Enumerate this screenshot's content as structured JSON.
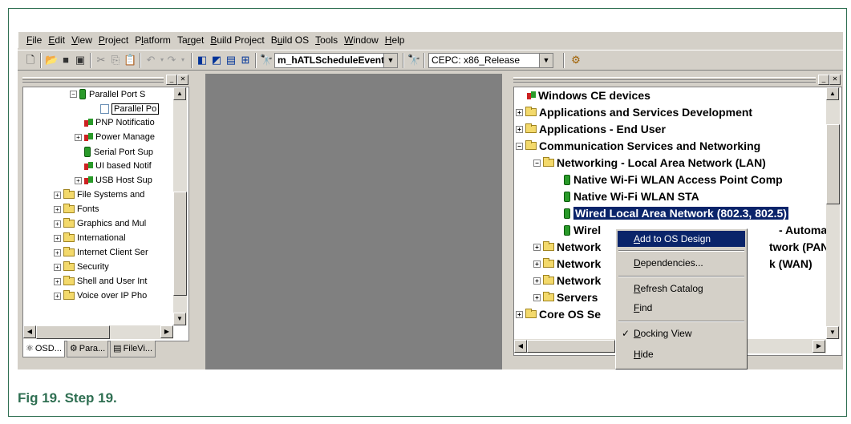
{
  "menubar": {
    "items": [
      {
        "label": "File",
        "key": "F"
      },
      {
        "label": "Edit",
        "key": "E"
      },
      {
        "label": "View",
        "key": "V"
      },
      {
        "label": "Project",
        "key": "P"
      },
      {
        "label": "Platform",
        "key": "l"
      },
      {
        "label": "Target",
        "key": "r"
      },
      {
        "label": "Build Project",
        "key": "B"
      },
      {
        "label": "Build OS",
        "key": "u"
      },
      {
        "label": "Tools",
        "key": "T"
      },
      {
        "label": "Window",
        "key": "W"
      },
      {
        "label": "Help",
        "key": "H"
      }
    ]
  },
  "toolbar": {
    "event_combo": "m_hATLScheduleEvent",
    "config_combo": "CEPC: x86_Release"
  },
  "left_tree": {
    "items": [
      {
        "label": "Parallel Port S",
        "icon": "component-icon",
        "expander": "−"
      },
      {
        "label": "Parallel Po",
        "icon": "page-icon",
        "expander": ""
      },
      {
        "label": "PNP Notificatio",
        "icon": "dual-component-icon",
        "expander": ""
      },
      {
        "label": "Power Manage",
        "icon": "dual-component-icon",
        "expander": "+"
      },
      {
        "label": "Serial Port Sup",
        "icon": "component-icon",
        "expander": ""
      },
      {
        "label": "UI based Notif",
        "icon": "dual-component-icon",
        "expander": ""
      },
      {
        "label": "USB Host Sup",
        "icon": "dual-component-icon",
        "expander": "+"
      },
      {
        "label": "File Systems and",
        "icon": "folder-icon",
        "expander": "+"
      },
      {
        "label": "Fonts",
        "icon": "folder-icon",
        "expander": "+"
      },
      {
        "label": "Graphics and Mul",
        "icon": "folder-icon",
        "expander": "+"
      },
      {
        "label": "International",
        "icon": "folder-icon",
        "expander": "+"
      },
      {
        "label": "Internet Client Ser",
        "icon": "folder-icon",
        "expander": "+"
      },
      {
        "label": "Security",
        "icon": "folder-icon",
        "expander": "+"
      },
      {
        "label": "Shell and User Int",
        "icon": "folder-icon",
        "expander": "+"
      },
      {
        "label": "Voice over IP Pho",
        "icon": "folder-icon",
        "expander": "+"
      }
    ],
    "tabs": [
      "OSD...",
      "Para...",
      "FileVi..."
    ]
  },
  "right_tree": {
    "items": [
      {
        "label": "Windows CE devices",
        "icon": "dual-component-icon",
        "expander": ""
      },
      {
        "label": "Applications and Services Development",
        "icon": "folder-icon",
        "expander": "+"
      },
      {
        "label": "Applications - End User",
        "icon": "folder-icon",
        "expander": "+"
      },
      {
        "label": "Communication Services and Networking",
        "icon": "open-folder-icon",
        "expander": "−"
      },
      {
        "label": "Networking - Local Area Network (LAN)",
        "icon": "open-folder-icon",
        "expander": "−"
      },
      {
        "label": "Native Wi-Fi WLAN Access Point Comp",
        "icon": "component-icon",
        "expander": ""
      },
      {
        "label": "Native Wi-Fi WLAN STA",
        "icon": "component-icon",
        "expander": ""
      },
      {
        "label": "Wired Local Area Network (802.3, 802.5)",
        "icon": "component-icon",
        "expander": ""
      },
      {
        "label": "Wirel",
        "icon": "component-icon",
        "expander": "",
        "tail": "- Automatic"
      },
      {
        "label": "Network",
        "icon": "folder-icon",
        "expander": "+",
        "tail": "twork (PAN)"
      },
      {
        "label": "Network",
        "icon": "folder-icon",
        "expander": "+",
        "tail": "k (WAN)"
      },
      {
        "label": "Network",
        "icon": "folder-icon",
        "expander": "+"
      },
      {
        "label": "Servers",
        "icon": "folder-icon",
        "expander": "+"
      },
      {
        "label": "Core OS Se",
        "icon": "folder-icon",
        "expander": "+"
      }
    ]
  },
  "context_menu": {
    "items": [
      {
        "label": "Add to OS Design",
        "key": "A"
      },
      {
        "label": "Dependencies...",
        "key": "D"
      },
      {
        "label": "Refresh Catalog",
        "key": "R"
      },
      {
        "label": "Find",
        "key": "F"
      },
      {
        "label": "Docking View",
        "key": "D",
        "checked": "✓"
      },
      {
        "label": "Hide",
        "key": "H"
      }
    ]
  },
  "caption": "Fig 19.  Step 19.",
  "colors": {
    "accent": "#2f6f52",
    "selection": "#0a246a",
    "workspace": "#808080"
  }
}
